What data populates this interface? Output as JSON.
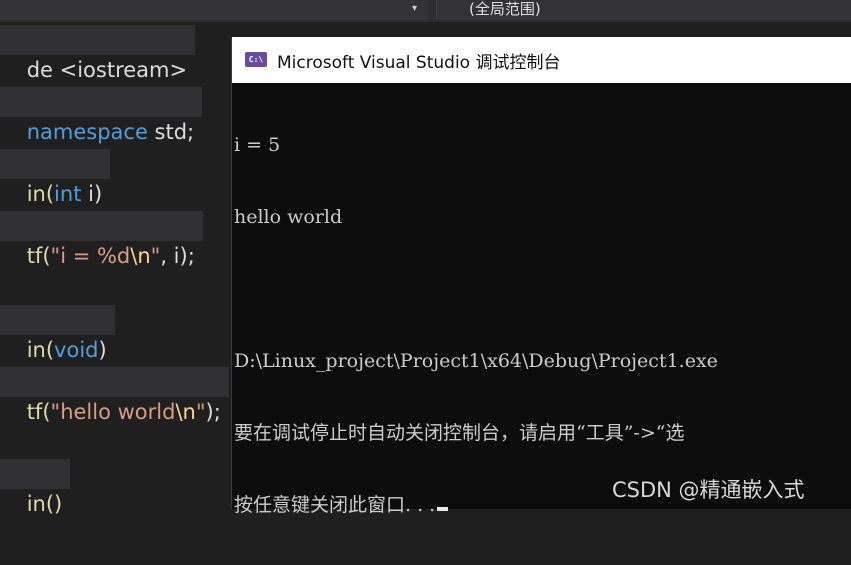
{
  "toolbar": {
    "scope": "(全局范围)",
    "dropdown_arrow": "▾"
  },
  "editor": {
    "lines": [
      {
        "parts": [
          "de <iostream>"
        ]
      },
      {
        "parts": [
          "namespace",
          " std;"
        ]
      },
      {
        "parts": [
          "in(",
          "int",
          " i)"
        ]
      },
      {
        "parts": [
          "tf(",
          "\"i = %d",
          "\\n",
          "\"",
          ", i);"
        ]
      },
      {
        "parts": [
          "in(",
          "void",
          ")"
        ]
      },
      {
        "parts": [
          "tf(",
          "\"hello world",
          "\\n",
          "\"",
          ");"
        ]
      },
      {
        "parts": [
          "in()"
        ]
      }
    ]
  },
  "console": {
    "title": "Microsoft Visual Studio 调试控制台",
    "icon_label": "C:\\",
    "output": [
      "i = 5",
      "hello world",
      "",
      "D:\\Linux_project\\Project1\\x64\\Debug\\Project1.exe",
      "要在调试停止时自动关闭控制台，请启用“工具”->“选",
      "按任意键关闭此窗口. . ."
    ]
  },
  "watermark": "CSDN @精通嵌入式",
  "colors": {
    "editor_bg": "#1f1f1f",
    "keyword": "#569cd6",
    "string": "#d69d85",
    "escape": "#ffd68f",
    "console_bg": "#0c0c0c"
  }
}
